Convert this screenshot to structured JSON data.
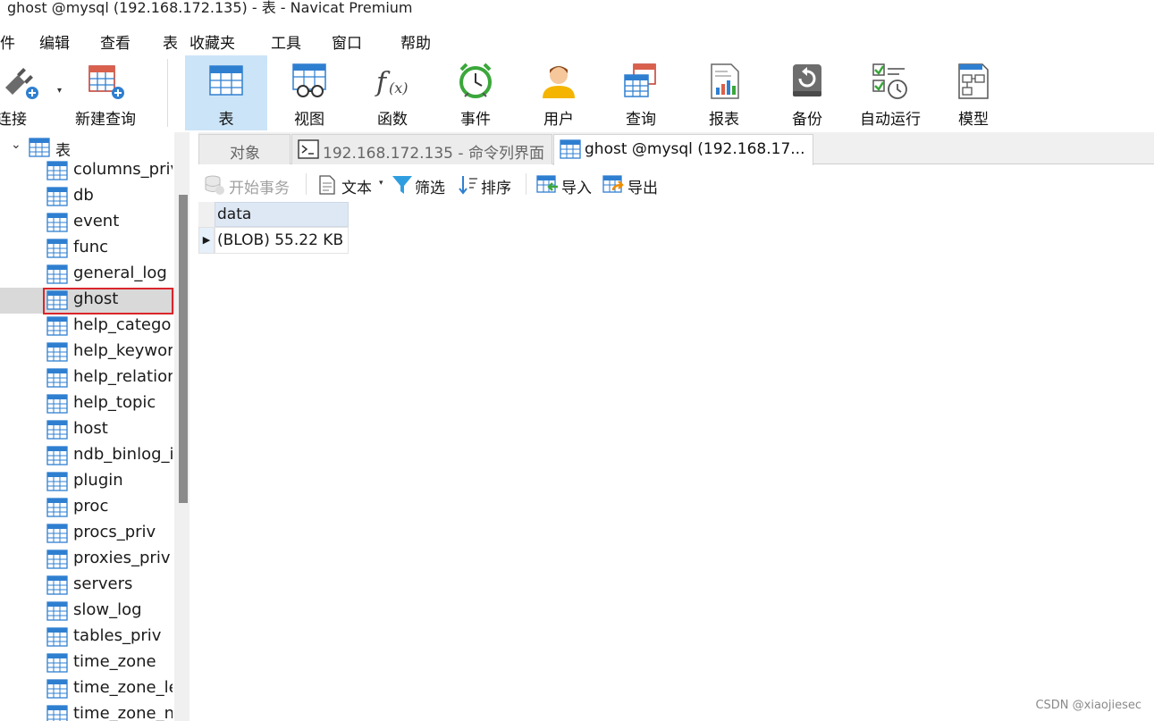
{
  "window": {
    "title": "ghost @mysql (192.168.172.135) - 表 - Navicat Premium"
  },
  "menu": [
    "件",
    "编辑",
    "查看",
    "表",
    "收藏夹",
    "工具",
    "窗口",
    "帮助"
  ],
  "toolbar": {
    "connect": "连接",
    "new_query": "新建查询",
    "table": "表",
    "view": "视图",
    "function": "函数",
    "event": "事件",
    "user": "用户",
    "query": "查询",
    "report": "报表",
    "backup": "备份",
    "automation": "自动运行",
    "model": "模型"
  },
  "sidebar": {
    "root_label": "表",
    "items": [
      "columns_priv",
      "db",
      "event",
      "func",
      "general_log",
      "ghost",
      "help_category",
      "help_keyword",
      "help_relation",
      "help_topic",
      "host",
      "ndb_binlog_index",
      "plugin",
      "proc",
      "procs_priv",
      "proxies_priv",
      "servers",
      "slow_log",
      "tables_priv",
      "time_zone",
      "time_zone_leap_second",
      "time_zone_name"
    ],
    "selected": "ghost"
  },
  "tabs": {
    "objects": "对象",
    "console": "192.168.172.135 - 命令列界面",
    "ghost": "ghost @mysql (192.168.17..."
  },
  "subtoolbar": {
    "begin_transaction": "开始事务",
    "text": "文本",
    "filter": "筛选",
    "sort": "排序",
    "import": "导入",
    "export": "导出"
  },
  "grid": {
    "column": "data",
    "row_marker": "▶",
    "value": "(BLOB) 55.22 KB"
  },
  "watermark": "CSDN @xiaojiesec"
}
